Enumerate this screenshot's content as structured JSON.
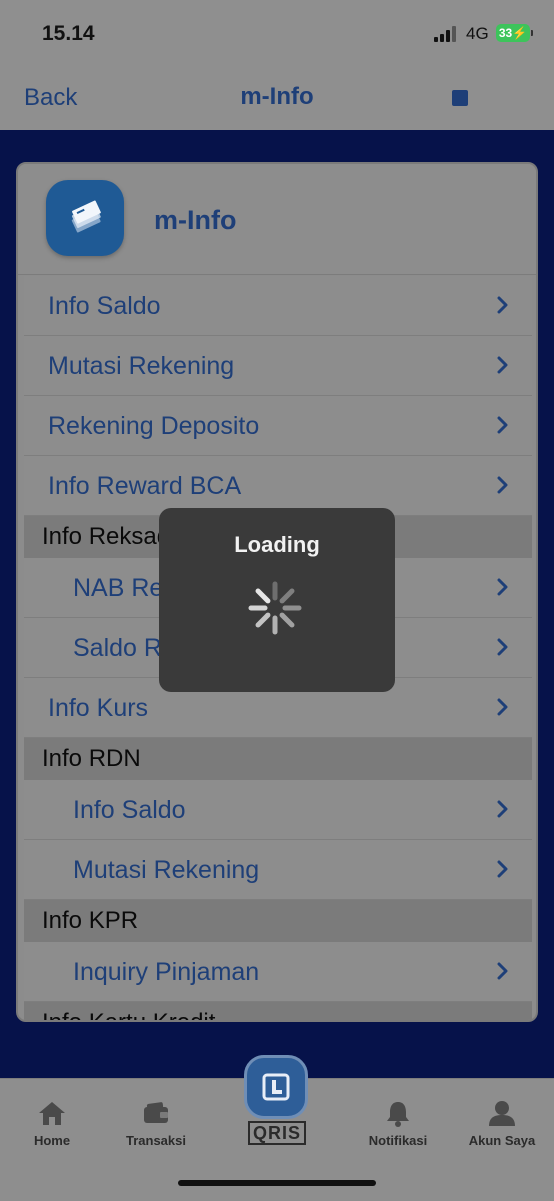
{
  "status_bar": {
    "time": "15.14",
    "network": "4G",
    "battery": "33"
  },
  "nav": {
    "back_label": "Back",
    "title": "m-Info"
  },
  "card": {
    "title": "m-Info"
  },
  "menu": [
    {
      "type": "item",
      "label": "Info Saldo",
      "sub": false
    },
    {
      "type": "item",
      "label": "Mutasi Rekening",
      "sub": false
    },
    {
      "type": "item",
      "label": "Rekening Deposito",
      "sub": false
    },
    {
      "type": "item",
      "label": "Info Reward BCA",
      "sub": false
    },
    {
      "type": "section",
      "label": "Info Reksadana"
    },
    {
      "type": "item",
      "label": "NAB Reksadana",
      "sub": true
    },
    {
      "type": "item",
      "label": "Saldo Reksadana",
      "sub": true
    },
    {
      "type": "item",
      "label": "Info Kurs",
      "sub": false
    },
    {
      "type": "section",
      "label": "Info RDN"
    },
    {
      "type": "item",
      "label": "Info Saldo",
      "sub": true
    },
    {
      "type": "item",
      "label": "Mutasi Rekening",
      "sub": true
    },
    {
      "type": "section",
      "label": "Info KPR"
    },
    {
      "type": "item",
      "label": "Inquiry Pinjaman",
      "sub": true
    },
    {
      "type": "section",
      "label": "Info Kartu Kredit"
    }
  ],
  "loading": {
    "text": "Loading"
  },
  "tabs": {
    "home": "Home",
    "transaksi": "Transaksi",
    "qris": "QRIS",
    "notifikasi": "Notifikasi",
    "akun": "Akun Saya"
  },
  "colors": {
    "accent": "#1e3f78",
    "background": "#06124a",
    "battery": "#3dc45b"
  }
}
